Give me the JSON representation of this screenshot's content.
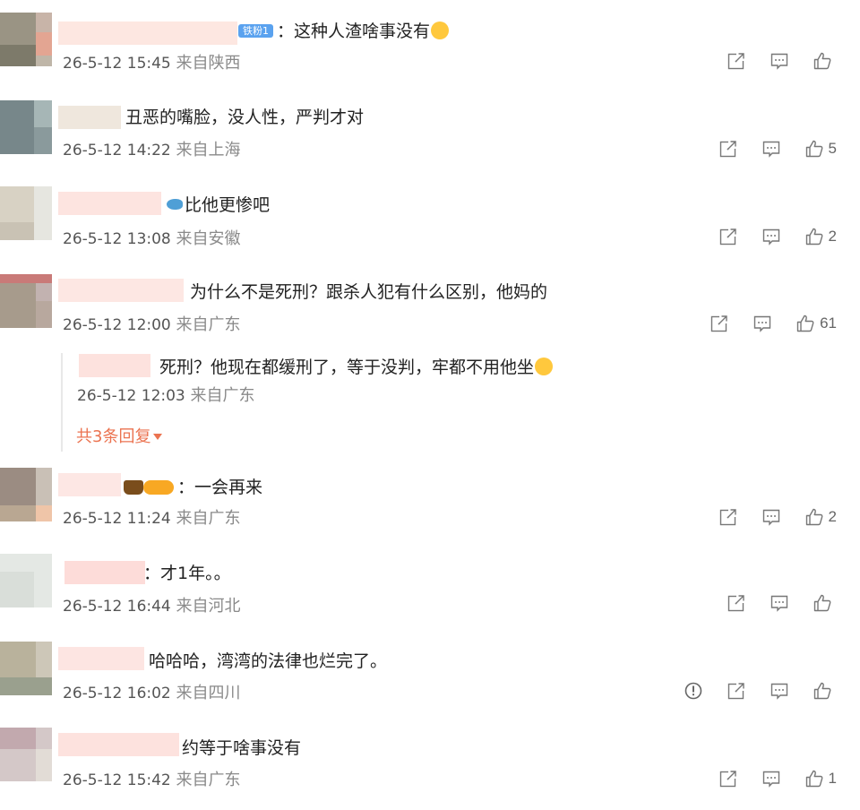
{
  "comments": [
    {
      "text": "：这种人渣啥事没有",
      "badge": "铁粉1",
      "time": "26-5-12 15:45",
      "location": "来自陕西",
      "likes": ""
    },
    {
      "text": "丑恶的嘴脸，没人性，严判才对",
      "time": "26-5-12 14:22",
      "location": "来自上海",
      "likes": "5"
    },
    {
      "text": "比他更惨吧",
      "time": "26-5-12 13:08",
      "location": "来自安徽",
      "likes": "2"
    },
    {
      "text": "为什么不是死刑？跟杀人犯有什么区别，他妈的",
      "time": "26-5-12 12:00",
      "location": "来自广东",
      "likes": "61"
    },
    {
      "text": "：一会再来",
      "time": "26-5-12 11:24",
      "location": "来自广东",
      "likes": "2"
    },
    {
      "text": "：才1年。。",
      "time": "26-5-12 16:44",
      "location": "来自河北",
      "likes": ""
    },
    {
      "text": "哈哈哈，湾湾的法律也烂完了。",
      "time": "26-5-12 16:02",
      "location": "来自四川",
      "likes": ""
    },
    {
      "text": "约等于啥事没有",
      "time": "26-5-12 15:42",
      "location": "来自广东",
      "likes": "1"
    }
  ],
  "reply": {
    "text": "死刑？他现在都缓刑了，等于没判，牢都不用他坐",
    "time": "26-5-12 12:03",
    "location": "来自广东"
  },
  "more_replies": "共3条回复",
  "colors": {
    "accent": "#eb7350",
    "muted": "#8a8a8a",
    "icon": "#777777"
  }
}
